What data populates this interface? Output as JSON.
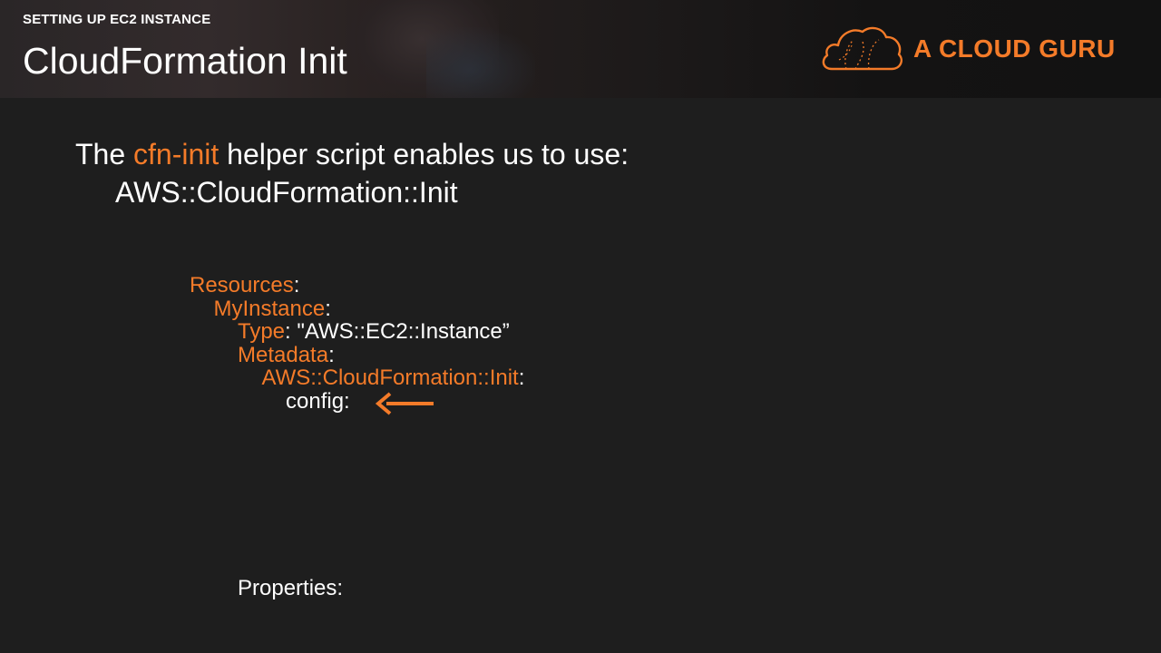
{
  "header": {
    "section": "SETTING UP EC2 INSTANCE",
    "title": "CloudFormation Init"
  },
  "brand": {
    "name": "A CLOUD GURU",
    "icon": "cloud-logo-icon",
    "color": "#f47b29"
  },
  "intro": {
    "prefix": "The ",
    "highlight": "cfn-init",
    "suffix": " helper script enables us to use:",
    "subject": "AWS::CloudFormation::Init"
  },
  "code": {
    "resources_key": "Resources",
    "instance_key": "MyInstance",
    "type_key": "Type",
    "type_value": "\"AWS::EC2::Instance”",
    "metadata_key": "Metadata",
    "init_key": "AWS::CloudFormation::Init",
    "config_key": "config:",
    "colon": ":",
    "properties_key": "Properties:"
  },
  "annotation": {
    "icon": "left-arrow-icon",
    "color": "#f47b29"
  },
  "colors": {
    "background": "#1e1e1e",
    "accent": "#f47b29",
    "text": "#ffffff"
  }
}
